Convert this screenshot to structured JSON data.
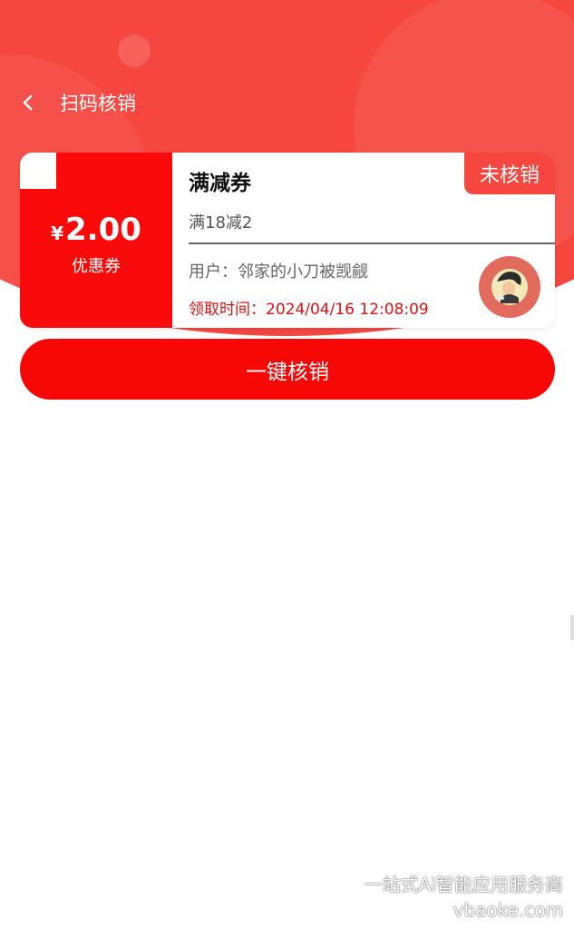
{
  "nav": {
    "title": "扫码核销"
  },
  "coupon": {
    "currency": "¥",
    "amount": "2.00",
    "kind": "优惠券",
    "name": "满减券",
    "rule": "满18减2",
    "user": "用户：邻家的小刀被觊觎",
    "claim_time": "领取时间：2024/04/16 12:08:09",
    "status": "未核销"
  },
  "actions": {
    "verify_label": "一键核销"
  },
  "watermark": {
    "line1": "一站式Ai智能应用服务商",
    "line2": "vbaoke.com"
  },
  "colors": {
    "brand_red": "#f5473f",
    "coupon_red": "#fa0a0a",
    "button_red": "#f80707",
    "time_red": "#e01010"
  }
}
